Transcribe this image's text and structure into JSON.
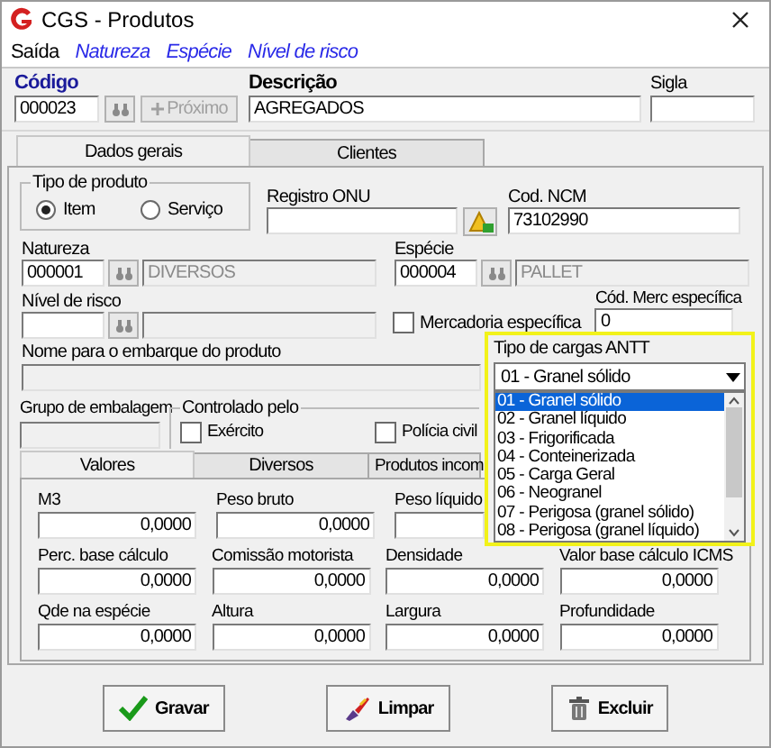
{
  "window": {
    "title": "CGS - Produtos"
  },
  "menu": [
    {
      "label": "Saída",
      "kind": "plain"
    },
    {
      "label": "Natureza",
      "kind": "link"
    },
    {
      "label": "Espécie",
      "kind": "link"
    },
    {
      "label": "Nível de risco",
      "kind": "link"
    }
  ],
  "codigo": {
    "label": "Código",
    "value": "000023"
  },
  "proximo": {
    "label": "Próximo",
    "disabled": true
  },
  "descricao": {
    "label": "Descrição",
    "value": "AGREGADOS"
  },
  "sigla": {
    "label": "Sigla"
  },
  "tabs": [
    {
      "label": "Dados gerais",
      "selected": true
    },
    {
      "label": "Clientes",
      "selected": false
    }
  ],
  "tipo_produto": {
    "label": "Tipo de produto",
    "options": [
      {
        "label": "Item",
        "selected": true
      },
      {
        "label": "Serviço",
        "selected": false
      }
    ]
  },
  "registro_onu": {
    "label": "Registro ONU"
  },
  "cod_ncm": {
    "label": "Cod. NCM",
    "value": "73102990"
  },
  "natureza": {
    "label": "Natureza",
    "code": "000001",
    "name": "DIVERSOS"
  },
  "especie": {
    "label": "Espécie",
    "code": "000004",
    "name": "PALLET"
  },
  "nivel_risco": {
    "label": "Nível de risco"
  },
  "mercadoria_especifica": {
    "label": "Mercadoria específica",
    "checked": false
  },
  "cod_merc": {
    "label": "Cód. Merc específica",
    "value": "0"
  },
  "nome_embarque": {
    "label": "Nome para o embarque do produto"
  },
  "grupo_embalagem": {
    "label": "Grupo de embalagem"
  },
  "controlado_pelo": {
    "label": "Controlado pelo",
    "options": [
      {
        "label": "Exército",
        "checked": false
      },
      {
        "label": "Polícia civil",
        "checked": false
      }
    ]
  },
  "inner_tabs": [
    {
      "label": "Valores",
      "selected": true
    },
    {
      "label": "Diversos",
      "selected": false
    },
    {
      "label": "Produtos incom",
      "selected": false
    }
  ],
  "value_rows": [
    [
      {
        "label": "M3",
        "value": "0,0000"
      },
      {
        "label": "Peso bruto",
        "value": "0,0000"
      },
      {
        "label": "Peso líquido"
      }
    ],
    [
      {
        "label": "Perc. base cálculo",
        "value": "0,0000"
      },
      {
        "label": "Comissão motorista",
        "value": "0,0000"
      },
      {
        "label": "Densidade",
        "value": "0,0000"
      },
      {
        "label": "Valor base cálculo ICMS",
        "value": "0,0000"
      }
    ],
    [
      {
        "label": "Qde na espécie",
        "value": "0,0000"
      },
      {
        "label": "Altura",
        "value": "0,0000"
      },
      {
        "label": "Largura",
        "value": "0,0000"
      },
      {
        "label": "Profundidade",
        "value": "0,0000"
      }
    ]
  ],
  "tipo_cargas": {
    "label": "Tipo de cargas ANTT",
    "value": "01 - Granel sólido",
    "options": [
      {
        "label": "01 - Granel sólido",
        "selected": true
      },
      {
        "label": "02 - Granel líquido",
        "selected": false
      },
      {
        "label": "03 - Frigorificada",
        "selected": false
      },
      {
        "label": "04 - Conteinerizada",
        "selected": false
      },
      {
        "label": "05 - Carga Geral",
        "selected": false
      },
      {
        "label": "06 - Neogranel",
        "selected": false
      },
      {
        "label": "07 - Perigosa (granel sólido)",
        "selected": false
      },
      {
        "label": "08 - Perigosa (granel líquido)",
        "selected": false
      }
    ]
  },
  "buttons": [
    {
      "label": "Gravar",
      "kind": "save"
    },
    {
      "label": "Limpar",
      "kind": "clear"
    },
    {
      "label": "Excluir",
      "kind": "delete"
    }
  ]
}
